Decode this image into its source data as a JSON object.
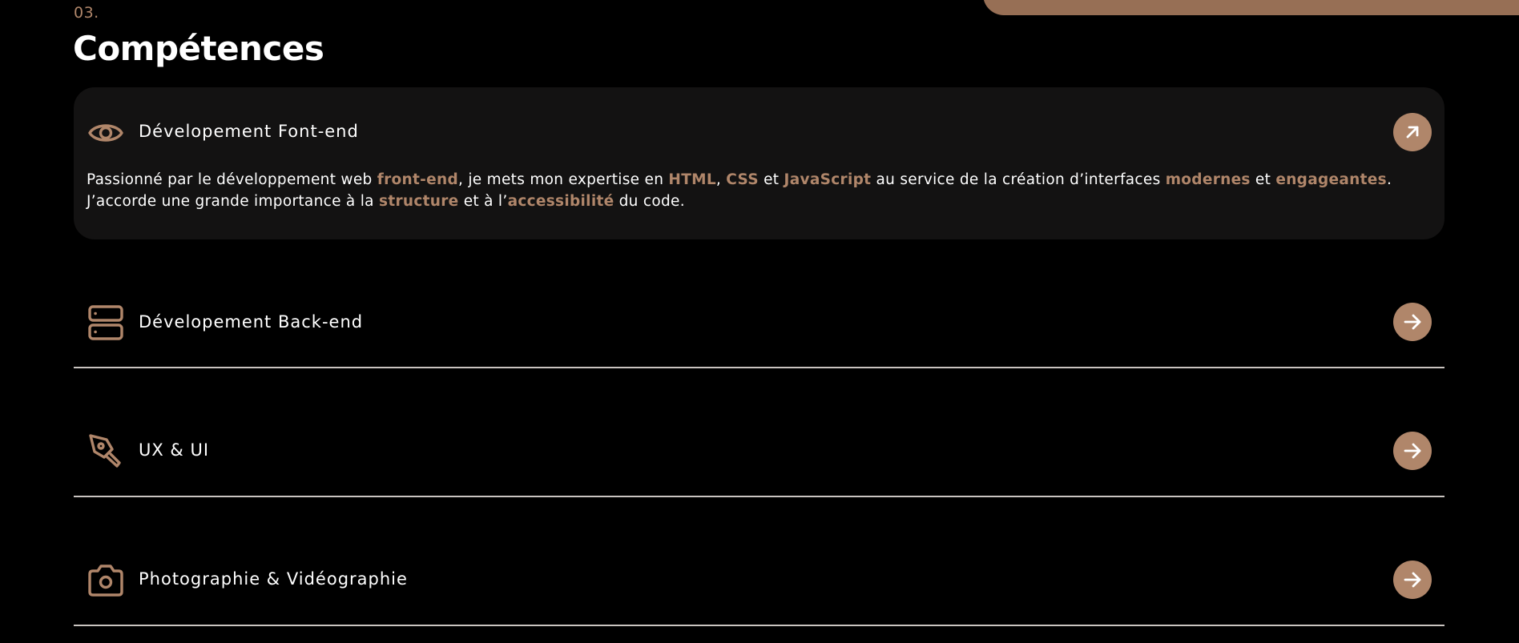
{
  "section": {
    "number": "03.",
    "title": "Compétences"
  },
  "skills": [
    {
      "title": "Dévelopement Font-end",
      "icon": "eye-icon",
      "expanded": true,
      "description": {
        "t1": "Passionné par le développement web ",
        "h1": "front-end",
        "t2": ", je mets mon expertise en ",
        "h2": "HTML",
        "t3": ", ",
        "h3": "CSS",
        "t4": " et ",
        "h4": "JavaScript",
        "t5": " au service de la création d’interfaces ",
        "h5": "modernes",
        "t6": " et ",
        "h6": "engageantes",
        "t7": ". J’accorde une grande importance à la ",
        "h7": "structure",
        "t8": " et à l’",
        "h8": "accessibilité",
        "t9": " du code."
      }
    },
    {
      "title": "Dévelopement Back-end",
      "icon": "server-icon",
      "expanded": false
    },
    {
      "title": "UX & UI",
      "icon": "pen-tool-icon",
      "expanded": false
    },
    {
      "title": "Photographie & Vidéographie",
      "icon": "camera-icon",
      "expanded": false
    }
  ],
  "colors": {
    "background": "#000000",
    "accent": "#b0866a",
    "card": "#131212",
    "decoration": "#976f55",
    "divider": "#c9c4c0"
  }
}
